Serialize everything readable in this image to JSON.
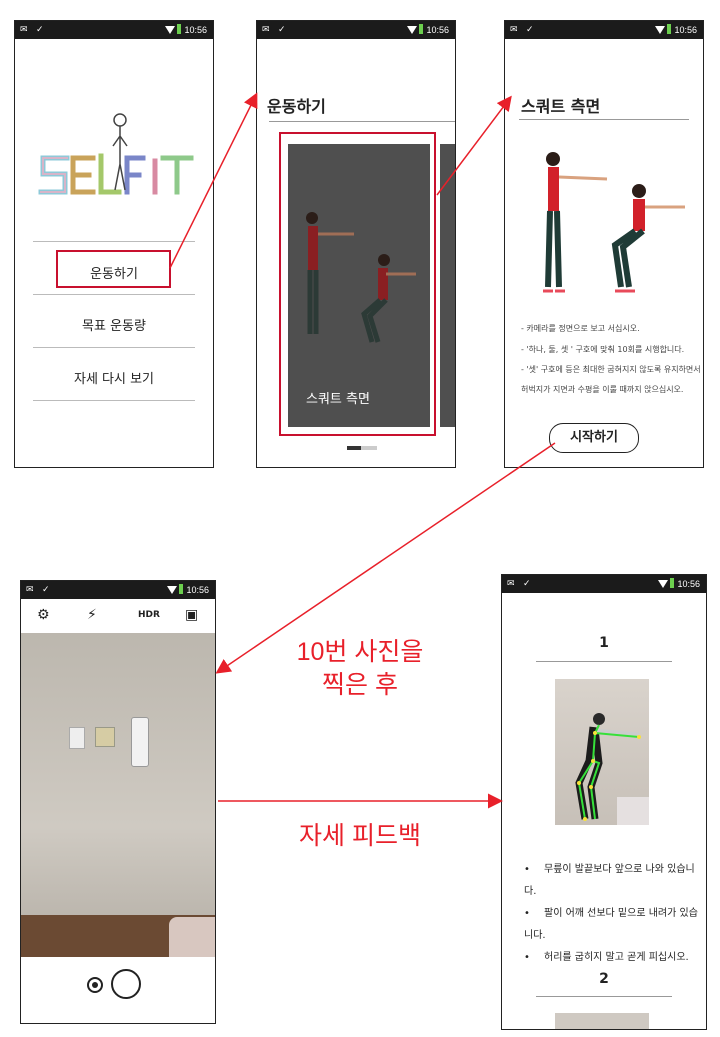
{
  "status_bar": {
    "time": "10:56",
    "left_icons": "✉ ✓"
  },
  "screen1": {
    "logo": "SELFIT",
    "menu": [
      "운동하기",
      "목표 운동량",
      "자세 다시 보기"
    ]
  },
  "screen2": {
    "title": "운동하기",
    "card_label": "스쿼트 측면"
  },
  "screen3": {
    "title": "스쿼트 측면",
    "instructions": [
      "- 카메라를 정면으로 보고 서십시오.",
      "- '하나, 둘, 셋 ' 구호에 맞춰 10회를 시행합니다.",
      "- '셋' 구호에 등은 최대한 굽혀지지 않도록 유지하면서",
      "허벅지가 지면과 수평을 이룰 때까지 앉으십시오."
    ],
    "start_button": "시작하기"
  },
  "camera": {
    "hdr": "HDR"
  },
  "annotations": {
    "after_photos_line1": "10번 사진을",
    "after_photos_line2": "찍은 후",
    "feedback": "자세 피드백"
  },
  "feedback_screen": {
    "item1_number": "1",
    "feedback_items": [
      "무릎이 발끝보다 앞으로 나와 있습니다.",
      "팔이 어깨 선보다 밑으로 내려가 있습니다.",
      "허리를 굽히지 말고 곧게 피십시오."
    ],
    "item2_number": "2"
  },
  "colors": {
    "accent_red": "#c8102e",
    "annotation_red": "#e8202a",
    "status_bar": "#1b1b1b",
    "card_dark": "#4f4f4f"
  }
}
